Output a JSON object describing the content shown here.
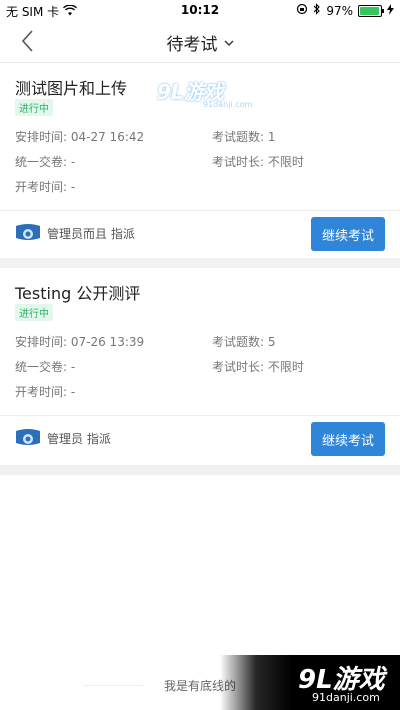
{
  "status_bar": {
    "carrier": "无 SIM 卡",
    "time": "10:12",
    "battery_percent": "97%",
    "battery_level": 0.97,
    "battery_color": "#34c759"
  },
  "nav": {
    "title": "待考试",
    "back_icon": "chevron-left-icon",
    "dropdown_icon": "chevron-down-icon"
  },
  "exams": [
    {
      "title": "测试图片和上传",
      "status": "进行中",
      "schedule_label": "安排时间:",
      "schedule_value": "04-27 16:42",
      "count_label": "考试题数:",
      "count_value": "1",
      "submit_label": "统一交卷:",
      "submit_value": "-",
      "duration_label": "考试时长:",
      "duration_value": "不限时",
      "start_label": "开考时间:",
      "start_value": "-",
      "assigner": "管理员而且 指派",
      "action": "继续考试"
    },
    {
      "title": "Testing 公开测评",
      "status": "进行中",
      "schedule_label": "安排时间:",
      "schedule_value": "07-26 13:39",
      "count_label": "考试题数:",
      "count_value": "5",
      "submit_label": "统一交卷:",
      "submit_value": "-",
      "duration_label": "考试时长:",
      "duration_value": "不限时",
      "start_label": "开考时间:",
      "start_value": "-",
      "assigner": "管理员 指派",
      "action": "继续考试"
    }
  ],
  "footer": {
    "text": "我是有底线的"
  },
  "watermark": {
    "logo": "9L游戏",
    "url": "91danji.com"
  },
  "colors": {
    "accent": "#2f85d8",
    "status_green": "#29b36a"
  }
}
